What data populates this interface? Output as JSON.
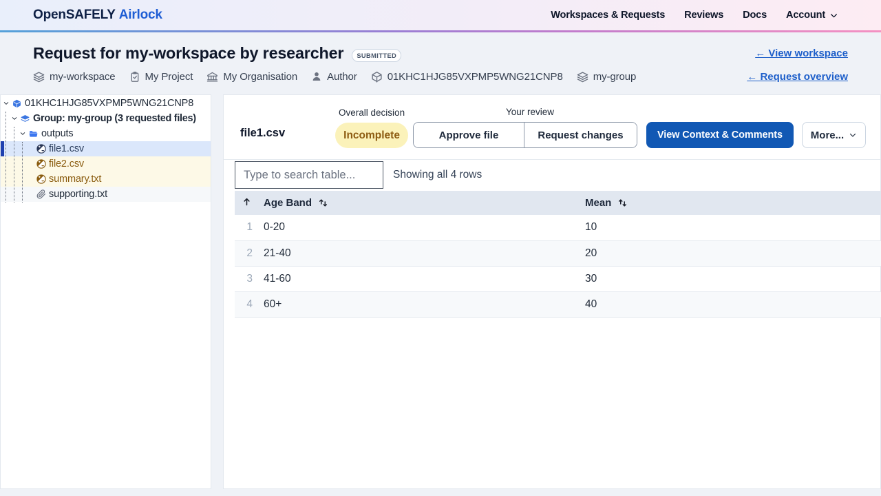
{
  "colors": {
    "primary_button": "#1158b4",
    "link": "#1e5fca",
    "brand_primary": "#0e2045",
    "brand_secondary": "#1e5dd4",
    "decision_badge_bg": "#fbf2ba",
    "decision_badge_text": "#8d5c12",
    "selected_file_bg": "#dbe7fb",
    "selected_file_bar": "#1e40af",
    "attention_file_bg": "#fdf9e7",
    "attention_file_text": "#8a5c0f",
    "table_header_bg": "#e1e7f0"
  },
  "navbar": {
    "brand_primary": "OpenSAFELY",
    "brand_secondary": "Airlock",
    "links": [
      {
        "label": "Workspaces & Requests"
      },
      {
        "label": "Reviews"
      },
      {
        "label": "Docs"
      }
    ],
    "account_label": "Account"
  },
  "header": {
    "title": "Request for my-workspace by researcher",
    "status_badge": "SUBMITTED",
    "view_workspace_link": "← View workspace",
    "request_overview_link": "← Request overview",
    "meta": [
      {
        "icon": "layers-icon",
        "label": "my-workspace"
      },
      {
        "icon": "clipboard-check-icon",
        "label": "My Project"
      },
      {
        "icon": "bank-icon",
        "label": "My Organisation"
      },
      {
        "icon": "person-icon",
        "label": "Author"
      },
      {
        "icon": "cube-icon",
        "label": "01KHC1HJG85VXPMP5WNG21CNP8"
      },
      {
        "icon": "layers-icon",
        "label": "my-group"
      }
    ]
  },
  "sidebar": {
    "tree": [
      {
        "depth": 0,
        "icon": "cube-icon",
        "label": "01KHC1HJG85VXPMP5WNG21CNP8",
        "expanded": true,
        "state": "normal"
      },
      {
        "depth": 1,
        "icon": "layers-icon",
        "label": "Group: my-group (3 requested files)",
        "expanded": true,
        "state": "normal",
        "bold": true
      },
      {
        "depth": 2,
        "icon": "folder-icon",
        "label": "outputs",
        "expanded": true,
        "state": "normal"
      },
      {
        "depth": 3,
        "icon": "chart-file-icon",
        "label": "file1.csv",
        "state": "selected"
      },
      {
        "depth": 3,
        "icon": "chart-file-icon",
        "label": "file2.csv",
        "state": "attention"
      },
      {
        "depth": 3,
        "icon": "chart-file-icon",
        "label": "summary.txt",
        "state": "attention"
      },
      {
        "depth": 3,
        "icon": "paperclip-icon",
        "label": "supporting.txt",
        "state": "supporting"
      }
    ]
  },
  "main": {
    "file_title": "file1.csv",
    "overall_decision_label": "Overall decision",
    "decision_badge": "Incomplete",
    "your_review_label": "Your review",
    "approve_button": "Approve file",
    "request_changes_button": "Request changes",
    "view_context_button": "View Context & Comments",
    "more_button": "More...",
    "search_placeholder": "Type to search table...",
    "rows_status": "Showing all 4 rows",
    "table": {
      "columns": [
        "Age Band",
        "Mean"
      ],
      "first_col_sort_icon": "sort-ascending-icon",
      "sortable_icon": "sort-up-down-icon",
      "rows": [
        {
          "num": "1",
          "age_band": "0-20",
          "mean": "10"
        },
        {
          "num": "2",
          "age_band": "21-40",
          "mean": "20"
        },
        {
          "num": "3",
          "age_band": "41-60",
          "mean": "30"
        },
        {
          "num": "4",
          "age_band": "60+",
          "mean": "40"
        }
      ]
    }
  }
}
